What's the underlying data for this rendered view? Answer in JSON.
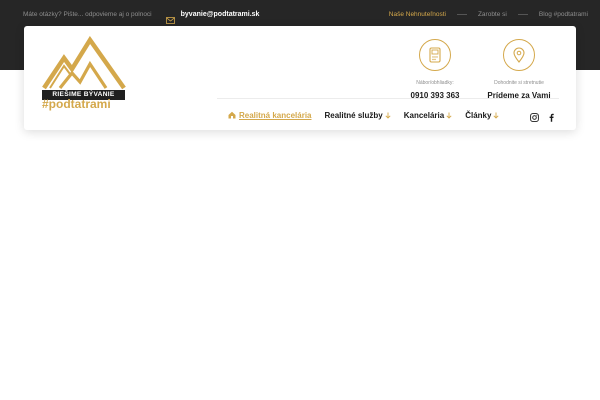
{
  "topbar": {
    "note": "Máte otázky? Pište... odpovieme aj o polnoci",
    "email": "byvanie@podtatrami.sk",
    "links": [
      {
        "label": "Naše Nehnuteľnosti",
        "active": true
      },
      {
        "label": "Zarobte si",
        "active": false
      },
      {
        "label": "Blog #podtatrami",
        "active": false
      }
    ]
  },
  "logo": {
    "band": "RIEŠIME BÝVANIE",
    "tag": "#podtatrami"
  },
  "contacts": [
    {
      "label": "Nábor/obhliadky:",
      "value": "0910 393 363",
      "icon": "phone-icon"
    },
    {
      "label": "Dohodnite si stretnutie",
      "value": "Prídeme za Vami",
      "icon": "map-pin-icon"
    }
  ],
  "nav": {
    "items": [
      {
        "label": "Realitná kancelária",
        "active": true
      },
      {
        "label": "Realitné služby",
        "active": false
      },
      {
        "label": "Kancelária",
        "active": false
      },
      {
        "label": "Články",
        "active": false
      }
    ]
  },
  "social": [
    "instagram-icon",
    "facebook-icon"
  ],
  "colors": {
    "accent": "#d4a84b",
    "dark": "#262626",
    "text": "#1a1a1a",
    "muted": "#8e8e8e"
  }
}
